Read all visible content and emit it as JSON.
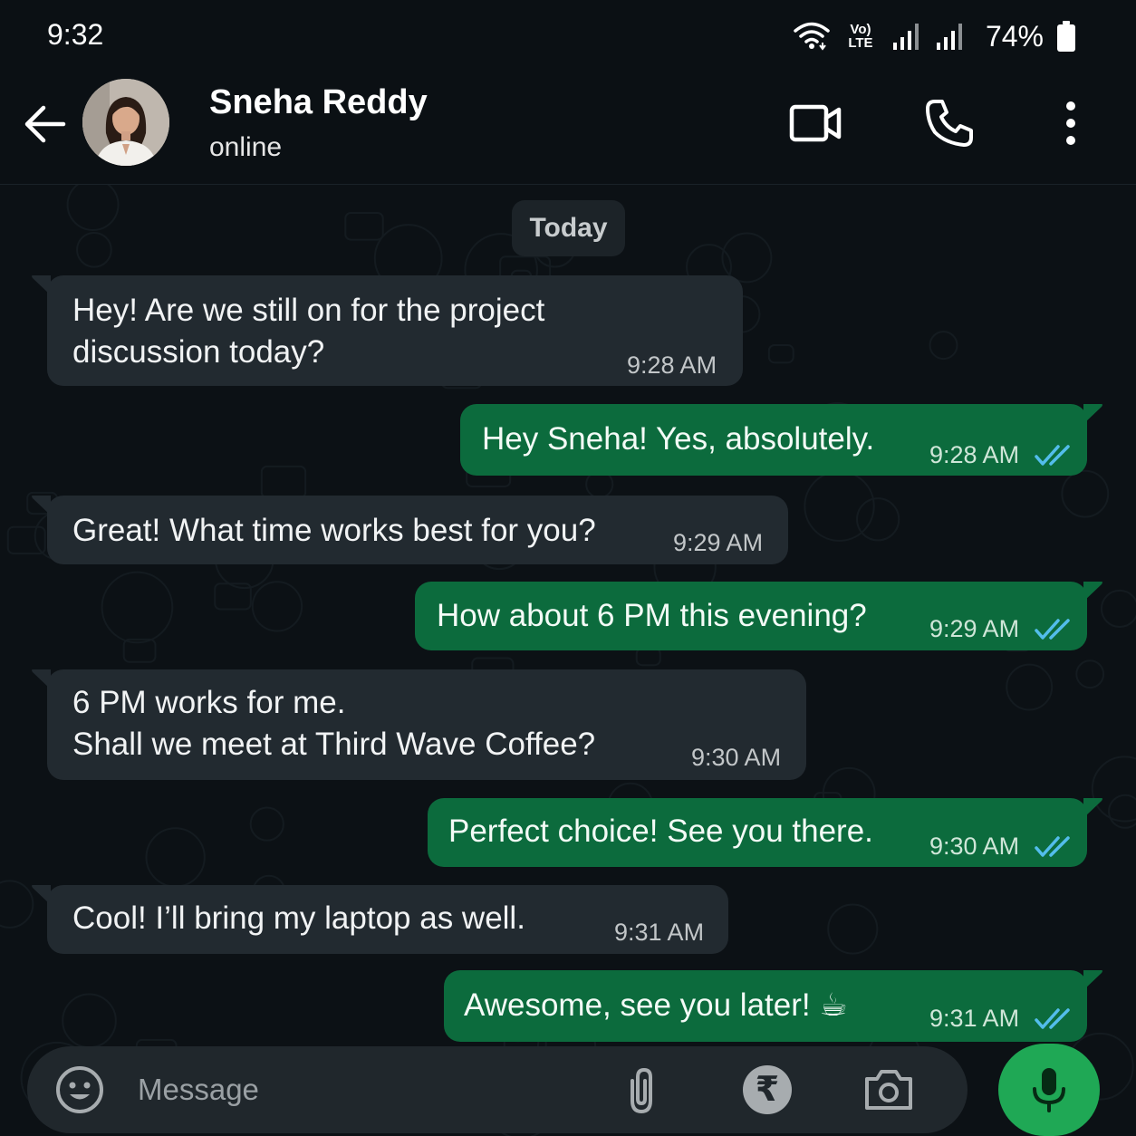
{
  "status_bar": {
    "time": "9:32",
    "battery": "74%",
    "network_label_top": "Vo)",
    "network_label_bottom": "LTE"
  },
  "header": {
    "contact_name": "Sneha Reddy",
    "contact_status": "online",
    "icons": [
      "back-arrow-icon",
      "video-call-icon",
      "phone-icon",
      "more-vert-icon"
    ]
  },
  "chat": {
    "date_label": "Today",
    "messages": [
      {
        "direction": "in",
        "text": "Hey! Are we still on for the project\ndiscussion today?",
        "time": "9:28 AM"
      },
      {
        "direction": "out",
        "text": "Hey Sneha! Yes, absolutely.",
        "time": "9:28 AM",
        "status": "read"
      },
      {
        "direction": "in",
        "text": "Great! What time works best for you?",
        "time": "9:29 AM"
      },
      {
        "direction": "out",
        "text": "How about 6 PM this evening?",
        "time": "9:29 AM",
        "status": "read"
      },
      {
        "direction": "in",
        "text": "6 PM works for me.\nShall we meet at Third Wave Coffee?",
        "time": "9:30 AM"
      },
      {
        "direction": "out",
        "text": "Perfect choice! See you there.",
        "time": "9:30 AM",
        "status": "read"
      },
      {
        "direction": "in",
        "text": "Cool! I’ll bring my laptop as well.",
        "time": "9:31 AM"
      },
      {
        "direction": "out",
        "text": "Awesome, see you later! ☕",
        "time": "9:31 AM",
        "status": "read"
      }
    ]
  },
  "composer": {
    "placeholder": "Message",
    "rupee_symbol": "₹",
    "icons": [
      "emoji-icon",
      "attach-icon",
      "rupee-icon",
      "camera-icon",
      "mic-icon"
    ]
  },
  "colors": {
    "incoming_bubble": "#222a30",
    "outgoing_bubble": "#0c6b3d",
    "read_ticks": "#53bdeb",
    "mic_button": "#1fa855",
    "background": "#0c1115"
  }
}
